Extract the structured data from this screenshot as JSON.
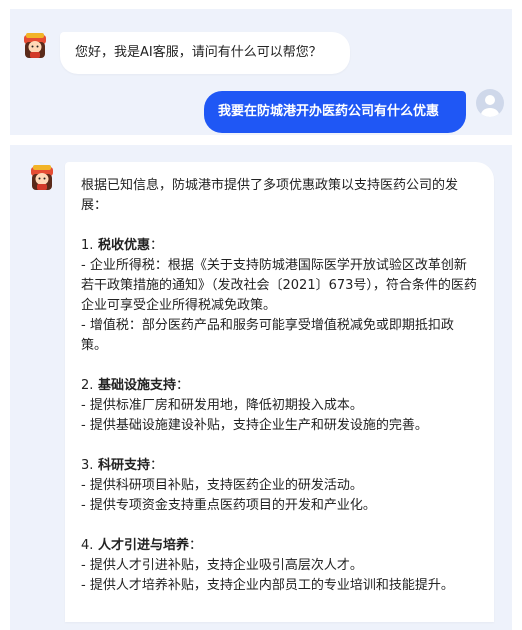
{
  "chat": {
    "greeting": "您好，我是AI客服，请问有什么可以帮您？",
    "user_question": "我要在防城港开办医药公司有什么优惠",
    "answer": {
      "intro": "根据已知信息，防城港市提供了多项优惠政策以支持医药公司的发展：",
      "sections": [
        {
          "num": "1.",
          "title": "税收优惠",
          "suffix": "：",
          "items": [
            "- 企业所得税：根据《关于支持防城港国际医学开放试验区改革创新若干政策措施的通知》（发改社会〔2021〕673号），符合条件的医药企业可享受企业所得税减免政策。",
            "- 增值税：部分医药产品和服务可能享受增值税减免或即期抵扣政策。"
          ]
        },
        {
          "num": "2.",
          "title": "基础设施支持",
          "suffix": "：",
          "items": [
            "- 提供标准厂房和研发用地，降低初期投入成本。",
            "- 提供基础设施建设补贴，支持企业生产和研发设施的完善。"
          ]
        },
        {
          "num": "3.",
          "title": "科研支持",
          "suffix": "：",
          "items": [
            "- 提供科研项目补贴，支持医药企业的研发活动。",
            "- 提供专项资金支持重点医药项目的开发和产业化。"
          ]
        },
        {
          "num": "4.",
          "title": "人才引进与培养",
          "suffix": "：",
          "items": [
            "- 提供人才引进补贴，支持企业吸引高层次人才。",
            "- 提供人才培养补贴，支持企业内部员工的专业培训和技能提升。"
          ]
        }
      ]
    }
  },
  "colors": {
    "panel_bg": "#eef2fb",
    "user_bubble": "#1f57f5",
    "bot_bubble": "#ffffff"
  },
  "icons": {
    "bot_avatar": "cartoon-character-avatar-icon",
    "user_avatar": "user-silhouette-avatar-icon"
  }
}
